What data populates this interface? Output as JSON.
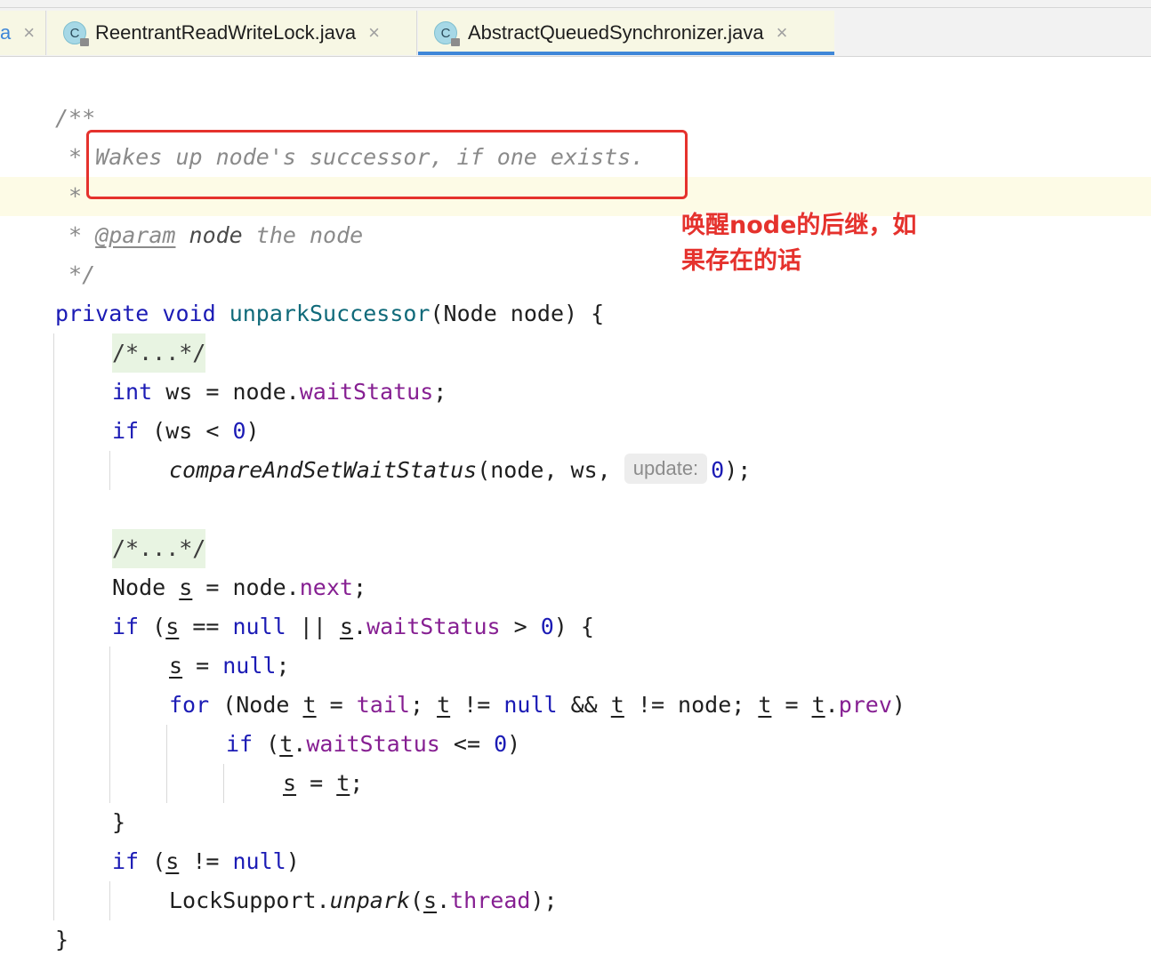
{
  "tabs": [
    {
      "label": "a",
      "close": "×"
    },
    {
      "label": "ReentrantReadWriteLock.java",
      "icon": "class-icon",
      "icon_letter": "C",
      "close": "×"
    },
    {
      "label": "AbstractQueuedSynchronizer.java",
      "icon": "class-icon",
      "icon_letter": "C",
      "close": "×",
      "active": true
    }
  ],
  "code": {
    "l1": "/**",
    "l2_star": " * ",
    "l2_text": "Wakes up node's successor, if one exists.",
    "l3": " *",
    "l4_star": " * ",
    "l4_tag": "@param",
    "l4_name": " node",
    "l4_desc": " the node",
    "l5": " */",
    "l6_kw1": "private",
    "l6_kw2": "void",
    "l6_fn": "unparkSuccessor",
    "l6_rest": "(Node node) {",
    "fold": "/*...*/",
    "l8_kw": "int",
    "l8_a": " ws = node.",
    "l8_fld": "waitStatus",
    "l8_b": ";",
    "l9_kw": "if",
    "l9_a": " (ws < ",
    "l9_num": "0",
    "l9_b": ")",
    "l10_fn": "compareAndSetWaitStatus",
    "l10_a": "(node, ws, ",
    "l10_hint": "update:",
    "l10_num": "0",
    "l10_b": ");",
    "l13_a": "Node ",
    "l13_var": "s",
    "l13_b": " = node.",
    "l13_fld": "next",
    "l13_c": ";",
    "l14_kw": "if",
    "l14_a": " (",
    "l14_var1": "s",
    "l14_b": " == ",
    "l14_null": "null",
    "l14_c": " || ",
    "l14_var2": "s",
    "l14_d": ".",
    "l14_fld": "waitStatus",
    "l14_e": " > ",
    "l14_num": "0",
    "l14_f": ") {",
    "l15_var": "s",
    "l15_a": " = ",
    "l15_null": "null",
    "l15_b": ";",
    "l16_kw": "for",
    "l16_a": " (Node ",
    "l16_t1": "t",
    "l16_b": " = ",
    "l16_fld": "tail",
    "l16_c": "; ",
    "l16_t2": "t",
    "l16_d": " != ",
    "l16_null": "null",
    "l16_e": " && ",
    "l16_t3": "t",
    "l16_f": " != node; ",
    "l16_t4": "t",
    "l16_g": " = ",
    "l16_t5": "t",
    "l16_h": ".",
    "l16_fld2": "prev",
    "l16_i": ")",
    "l17_kw": "if",
    "l17_a": " (",
    "l17_t": "t",
    "l17_b": ".",
    "l17_fld": "waitStatus",
    "l17_c": " <= ",
    "l17_num": "0",
    "l17_d": ")",
    "l18_s": "s",
    "l18_a": " = ",
    "l18_t": "t",
    "l18_b": ";",
    "l19": "}",
    "l20_kw": "if",
    "l20_a": " (",
    "l20_s": "s",
    "l20_b": " != ",
    "l20_null": "null",
    "l20_c": ")",
    "l21_a": "LockSupport.",
    "l21_fn": "unpark",
    "l21_b": "(",
    "l21_s": "s",
    "l21_c": ".",
    "l21_fld": "thread",
    "l21_d": ");",
    "l22": "}"
  },
  "annotation": {
    "note": "唤醒node的后继，如果存在的话",
    "color": "#e5322d"
  }
}
